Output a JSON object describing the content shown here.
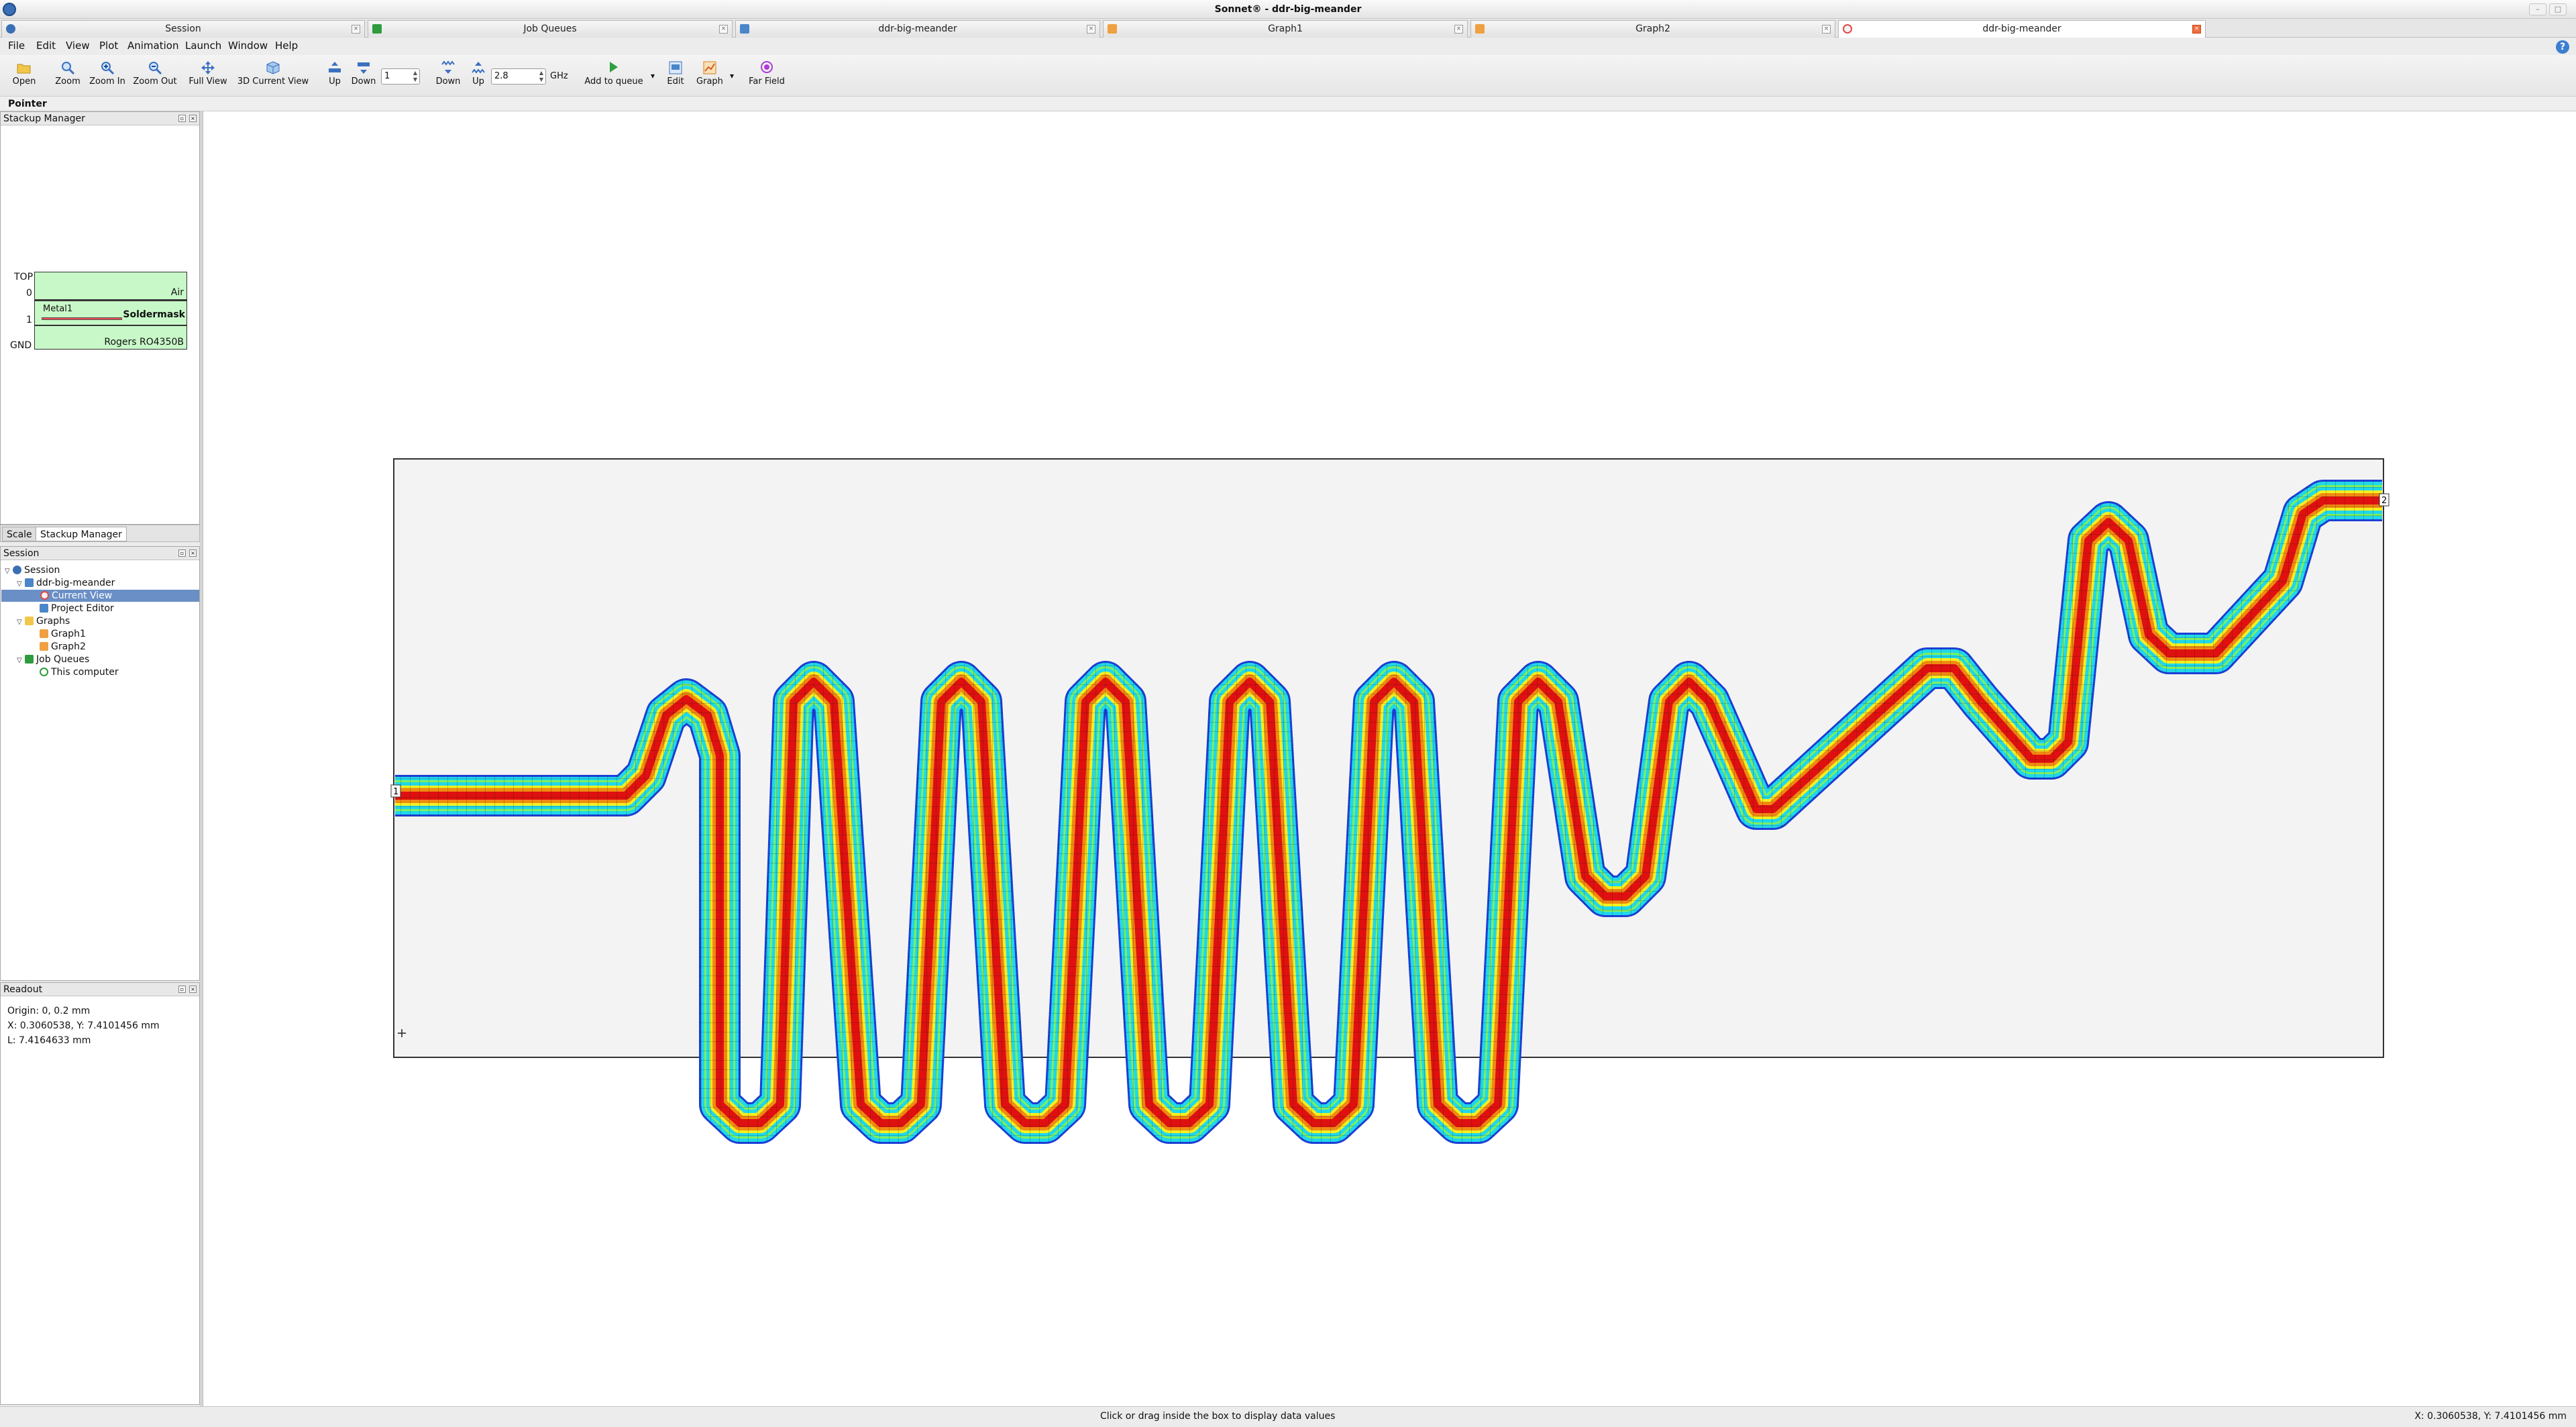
{
  "window": {
    "title": "Sonnet® - ddr-big-meander"
  },
  "tabs": [
    {
      "label": "Session",
      "icon": "session-icon",
      "active": false
    },
    {
      "label": "Job Queues",
      "icon": "job-queue-icon",
      "active": false
    },
    {
      "label": "ddr-big-meander",
      "icon": "project-editor-icon",
      "active": false
    },
    {
      "label": "Graph1",
      "icon": "graph-icon",
      "active": false
    },
    {
      "label": "Graph2",
      "icon": "graph-icon",
      "active": false
    },
    {
      "label": "ddr-big-meander",
      "icon": "current-view-icon",
      "active": true
    }
  ],
  "menu": [
    "File",
    "Edit",
    "View",
    "Plot",
    "Animation",
    "Launch",
    "Window",
    "Help"
  ],
  "toolbar": {
    "open": "Open",
    "zoom": "Zoom",
    "zoom_in": "Zoom In",
    "zoom_out": "Zoom Out",
    "full_view": "Full View",
    "current_view_3d": "3D Current View",
    "level_up": "Up",
    "level_down": "Down",
    "level_value": "1",
    "freq_down": "Down",
    "freq_up": "Up",
    "freq_value": "2.8",
    "freq_unit": "GHz",
    "add_to_queue": "Add to queue",
    "edit": "Edit",
    "graph": "Graph",
    "far_field": "Far Field"
  },
  "mode": "Pointer",
  "stackup": {
    "title": "Stackup Manager",
    "left_labels": [
      "TOP",
      "0",
      "1",
      "GND"
    ],
    "air": "Air",
    "metal": "Metal1",
    "soldermask": "Soldermask",
    "dielectric": "Rogers RO4350B",
    "tabs": [
      "Scale",
      "Stackup Manager"
    ]
  },
  "session": {
    "title": "Session",
    "tree": [
      {
        "label": "Session",
        "level": 0,
        "expanded": true,
        "icon": "session-icon"
      },
      {
        "label": "ddr-big-meander",
        "level": 1,
        "expanded": true,
        "icon": "project-icon"
      },
      {
        "label": "Current View",
        "level": 2,
        "selected": true,
        "icon": "current-view-icon"
      },
      {
        "label": "Project Editor",
        "level": 2,
        "icon": "project-editor-icon"
      },
      {
        "label": "Graphs",
        "level": 1,
        "expanded": true,
        "icon": "folder-icon"
      },
      {
        "label": "Graph1",
        "level": 2,
        "icon": "graph-icon"
      },
      {
        "label": "Graph2",
        "level": 2,
        "icon": "graph-icon"
      },
      {
        "label": "Job Queues",
        "level": 1,
        "expanded": true,
        "icon": "job-queue-icon"
      },
      {
        "label": "This computer",
        "level": 2,
        "icon": "check-icon"
      }
    ]
  },
  "readout": {
    "title": "Readout",
    "lines": [
      "Origin: 0, 0.2 mm",
      "X: 0.3060538, Y: 7.4101456 mm",
      "L: 7.4164633 mm"
    ]
  },
  "canvas": {
    "port1": "1",
    "port2": "2"
  },
  "status": {
    "hint": "Click or drag inside the box to display data values",
    "coords": "X: 0.3060538, Y: 7.4101456 mm"
  },
  "colors": {
    "current_high": "#e01010",
    "current_midhigh": "#f08a10",
    "current_mid": "#f3f020",
    "current_midlow": "#7df060",
    "current_low": "#20d8e8",
    "current_min": "#1c3fd8",
    "selection": "#6a8fc6"
  }
}
